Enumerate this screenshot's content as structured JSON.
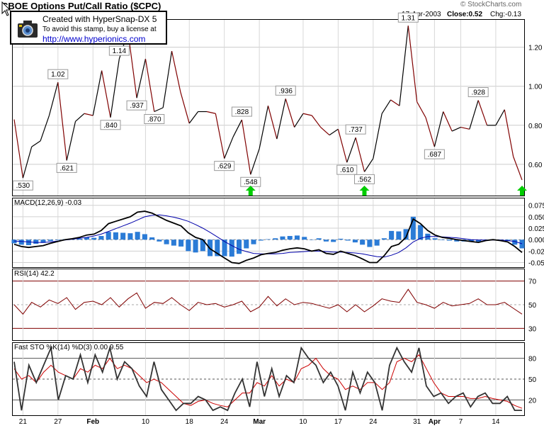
{
  "header": {
    "title": "CBOE Options Put/Call Ratio ($CPC)",
    "watermark": "© StockCharts.com",
    "date": "17-Apr-2003",
    "close": "Close:0.52",
    "chg": "Chg:-0.13"
  },
  "stamp": {
    "line1": "Created with HyperSnap-DX 5",
    "line2": "To avoid this stamp, buy a license at",
    "line3": "http://www.hyperionics.com"
  },
  "chart_data": [
    {
      "type": "line",
      "title": "CBOE Options Put/Call Ratio ($CPC)",
      "ylim": [
        0.44,
        1.34
      ],
      "yticks": [
        "0.60",
        "0.80",
        "1.00",
        "1.20"
      ],
      "values": [
        0.83,
        0.53,
        0.69,
        0.72,
        0.85,
        1.02,
        0.62,
        0.82,
        0.86,
        0.85,
        1.08,
        0.84,
        1.14,
        1.28,
        0.94,
        1.14,
        0.87,
        0.89,
        1.18,
        0.97,
        0.81,
        0.87,
        0.87,
        0.86,
        0.63,
        0.74,
        0.828,
        0.548,
        0.68,
        0.9,
        0.73,
        0.936,
        0.79,
        0.86,
        0.85,
        0.79,
        0.75,
        0.78,
        0.61,
        0.737,
        0.562,
        0.63,
        0.86,
        0.93,
        0.9,
        1.31,
        0.92,
        0.84,
        0.69,
        0.87,
        0.77,
        0.79,
        0.78,
        0.928,
        0.8,
        0.8,
        0.88,
        0.64,
        0.52
      ],
      "annotations": [
        {
          "i": 1,
          "label": ".530",
          "pos": "below"
        },
        {
          "i": 5,
          "label": "1.02",
          "pos": "above"
        },
        {
          "i": 6,
          "label": ".621",
          "pos": "below"
        },
        {
          "i": 11,
          "label": ".840",
          "pos": "below"
        },
        {
          "i": 12,
          "label": "1.14",
          "pos": "above"
        },
        {
          "i": 14,
          "label": ".937",
          "pos": "below"
        },
        {
          "i": 16,
          "label": ".870",
          "pos": "below"
        },
        {
          "i": 24,
          "label": ".629",
          "pos": "below"
        },
        {
          "i": 26,
          "label": ".828",
          "pos": "above"
        },
        {
          "i": 27,
          "label": ".548",
          "pos": "below"
        },
        {
          "i": 31,
          "label": ".936",
          "pos": "above"
        },
        {
          "i": 38,
          "label": ".610",
          "pos": "below"
        },
        {
          "i": 39,
          "label": ".737",
          "pos": "above"
        },
        {
          "i": 40,
          "label": ".562",
          "pos": "below"
        },
        {
          "i": 45,
          "label": "1.31",
          "pos": "above"
        },
        {
          "i": 48,
          "label": ".687",
          "pos": "below"
        },
        {
          "i": 53,
          "label": ".928",
          "pos": "above"
        }
      ],
      "signals": [
        27,
        40,
        58
      ]
    },
    {
      "type": "line",
      "title": "MACD(12,26,9)",
      "value_label": "-0.03",
      "ylim": [
        -0.06,
        0.09
      ],
      "yticks": [
        "0.075",
        "0.050",
        "0.025",
        "0.000",
        "-0.025",
        "-0.050"
      ],
      "series": [
        {
          "values": [
            -0.01,
            -0.015,
            -0.017,
            -0.015,
            -0.013,
            -0.008,
            -0.004,
            0.0,
            0.002,
            0.005,
            0.01,
            0.012,
            0.02,
            0.035,
            0.04,
            0.045,
            0.05,
            0.06,
            0.062,
            0.058,
            0.05,
            0.042,
            0.036,
            0.03,
            0.015,
            0.005,
            0.0,
            -0.02,
            -0.03,
            -0.04,
            -0.05,
            -0.052,
            -0.045,
            -0.04,
            -0.033,
            -0.03,
            -0.028,
            -0.023,
            -0.02,
            -0.018,
            -0.02,
            -0.025,
            -0.022,
            -0.03,
            -0.032,
            -0.025,
            -0.03,
            -0.035,
            -0.042,
            -0.05,
            -0.05,
            -0.035,
            -0.015,
            -0.01,
            0.005,
            0.045,
            0.035,
            0.02,
            0.01,
            0.005,
            0.003,
            0.0,
            -0.002,
            -0.004,
            -0.006,
            -0.002,
            0.0,
            -0.002,
            -0.005,
            -0.015,
            -0.028
          ]
        },
        {
          "values": [
            -0.003,
            -0.004,
            -0.005,
            -0.006,
            -0.006,
            -0.005,
            -0.003,
            -0.001,
            0.001,
            0.003,
            0.005,
            0.008,
            0.012,
            0.018,
            0.024,
            0.03,
            0.036,
            0.043,
            0.05,
            0.053,
            0.054,
            0.052,
            0.049,
            0.045,
            0.04,
            0.033,
            0.025,
            0.016,
            0.006,
            -0.004,
            -0.013,
            -0.021,
            -0.026,
            -0.03,
            -0.031,
            -0.031,
            -0.031,
            -0.03,
            -0.028,
            -0.027,
            -0.026,
            -0.025,
            -0.025,
            -0.026,
            -0.027,
            -0.027,
            -0.028,
            -0.029,
            -0.031,
            -0.034,
            -0.037,
            -0.038,
            -0.034,
            -0.028,
            -0.018,
            -0.005,
            0.003,
            0.007,
            0.007,
            0.006,
            0.005,
            0.004,
            0.002,
            0.0,
            -0.001,
            -0.001,
            -0.001,
            -0.001,
            -0.002,
            -0.004,
            -0.009
          ]
        },
        {
          "values": [
            -0.008,
            -0.011,
            -0.012,
            -0.009,
            -0.007,
            -0.003,
            -0.001,
            0.001,
            0.001,
            0.002,
            0.005,
            0.004,
            0.008,
            0.017,
            0.016,
            0.015,
            0.014,
            0.017,
            0.012,
            0.005,
            -0.004,
            -0.01,
            -0.013,
            -0.015,
            -0.025,
            -0.028,
            -0.025,
            -0.036,
            -0.036,
            -0.036,
            -0.037,
            -0.031,
            -0.019,
            -0.01,
            -0.002,
            0.001,
            0.003,
            0.007,
            0.008,
            0.009,
            0.006,
            0.0,
            0.003,
            -0.004,
            -0.005,
            0.002,
            -0.002,
            -0.006,
            -0.011,
            -0.016,
            -0.013,
            0.003,
            0.019,
            0.018,
            0.023,
            0.05,
            0.032,
            0.013,
            0.003,
            -0.001,
            -0.002,
            -0.004,
            -0.004,
            -0.004,
            -0.005,
            -0.001,
            0.001,
            -0.001,
            -0.003,
            -0.011,
            -0.019
          ]
        }
      ]
    },
    {
      "type": "line",
      "title": "RSI(14)",
      "value_label": "42.2",
      "ylim": [
        20,
        80
      ],
      "yticks": [
        "30",
        "50",
        "70"
      ],
      "values": [
        50,
        42,
        52,
        48,
        54,
        51,
        56,
        46,
        52,
        53,
        50,
        56,
        48,
        55,
        60,
        47,
        52,
        51,
        56,
        50,
        45,
        52,
        50,
        51,
        48,
        50,
        53,
        44,
        48,
        57,
        49,
        55,
        50,
        52,
        51,
        49,
        47,
        50,
        44,
        50,
        44,
        49,
        55,
        53,
        52,
        63,
        52,
        50,
        47,
        52,
        49,
        50,
        51,
        55,
        50,
        50,
        52,
        47,
        42
      ],
      "bands": [
        30,
        50,
        70
      ]
    },
    {
      "type": "line",
      "title": "Fast STO %K(14) %D(3)",
      "k_label": "0.00",
      "d_label": "9.55",
      "ylim": [
        0,
        100
      ],
      "yticks": [
        "20",
        "50",
        "80"
      ],
      "series": [
        {
          "values": [
            75,
            5,
            70,
            45,
            70,
            95,
            20,
            55,
            50,
            85,
            45,
            85,
            60,
            95,
            50,
            75,
            65,
            40,
            25,
            75,
            35,
            20,
            5,
            15,
            15,
            25,
            20,
            5,
            10,
            5,
            30,
            50,
            10,
            75,
            25,
            65,
            25,
            55,
            45,
            95,
            80,
            70,
            45,
            60,
            40,
            5,
            60,
            30,
            60,
            45,
            5,
            70,
            95,
            75,
            60,
            95,
            40,
            25,
            30,
            15,
            25,
            30,
            10,
            25,
            30,
            15,
            15,
            25,
            5,
            5
          ]
        },
        {
          "values": [
            65,
            50,
            55,
            45,
            60,
            70,
            60,
            55,
            50,
            65,
            60,
            70,
            65,
            80,
            65,
            70,
            65,
            55,
            45,
            50,
            45,
            35,
            25,
            15,
            12,
            18,
            20,
            15,
            12,
            10,
            20,
            30,
            30,
            45,
            40,
            55,
            40,
            50,
            45,
            65,
            70,
            80,
            65,
            55,
            50,
            35,
            40,
            35,
            45,
            45,
            35,
            45,
            75,
            80,
            75,
            85,
            65,
            45,
            30,
            25,
            25,
            25,
            22,
            22,
            25,
            22,
            20,
            18,
            12,
            8
          ]
        }
      ],
      "bands": [
        20,
        50,
        80
      ]
    }
  ],
  "xaxis": {
    "labels": [
      {
        "text": "21",
        "i": 1
      },
      {
        "text": "27",
        "i": 5
      },
      {
        "text": "Feb",
        "i": 9
      },
      {
        "text": "10",
        "i": 15
      },
      {
        "text": "18",
        "i": 20
      },
      {
        "text": "24",
        "i": 24
      },
      {
        "text": "Mar",
        "i": 28
      },
      {
        "text": "10",
        "i": 33
      },
      {
        "text": "17",
        "i": 37
      },
      {
        "text": "24",
        "i": 41
      },
      {
        "text": "31",
        "i": 46
      },
      {
        "text": "Apr",
        "i": 48
      },
      {
        "text": "7",
        "i": 51
      },
      {
        "text": "14",
        "i": 55
      }
    ]
  },
  "colors": {
    "price_up": "#000000",
    "price_down": "#800000",
    "macd": "#000000",
    "signal": "#0000aa",
    "hist": "#2b7bd6",
    "stoch_k": "#333333",
    "stoch_d": "#cc0000",
    "band": "#800000",
    "arrow": "#00cc00"
  }
}
